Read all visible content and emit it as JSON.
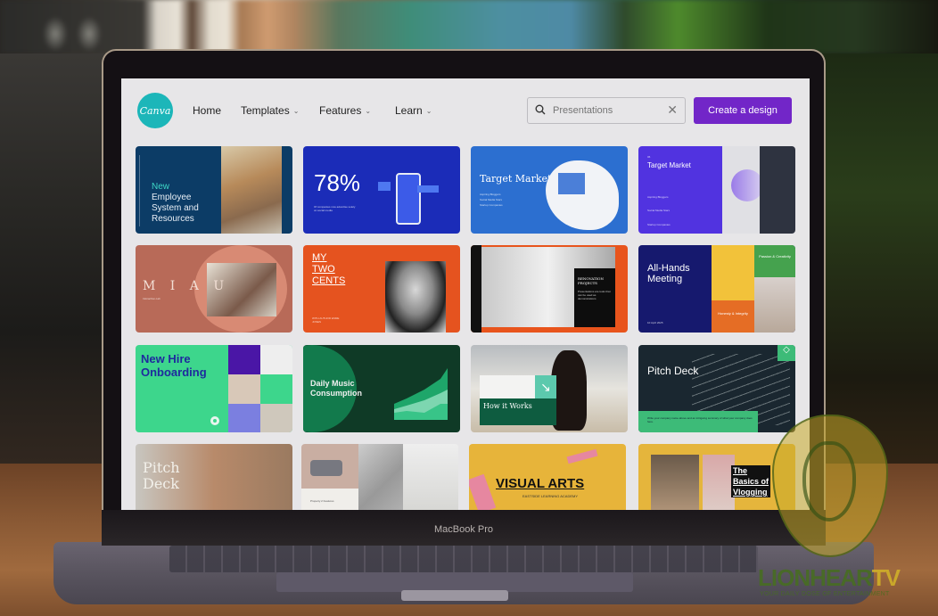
{
  "scene": {
    "device_label": "MacBook Pro",
    "watermark": {
      "brand_main": "LIONHEAR",
      "brand_accent": "TV",
      "tagline": "YOUR DAILY DOSE OF ENTERTAINMENT"
    }
  },
  "header": {
    "logo_text": "Canva",
    "nav": [
      {
        "label": "Home",
        "has_dropdown": false
      },
      {
        "label": "Templates",
        "has_dropdown": true
      },
      {
        "label": "Features",
        "has_dropdown": true
      },
      {
        "label": "Learn",
        "has_dropdown": true
      }
    ],
    "search": {
      "value": "",
      "placeholder": "Presentations"
    },
    "cta_label": "Create a design",
    "cta_color": "#7226c8",
    "brand_color": "#1cb6b9"
  },
  "templates": [
    {
      "title": "New",
      "title2": "Employee System and Resources",
      "bg": "#0c3c66",
      "accent": "#3dd6c6"
    },
    {
      "title": "78%",
      "subtitle": "Of companies now advertise solely on social media",
      "bg": "#1b2cb8"
    },
    {
      "title": "Target Market",
      "items": [
        "Aspiring Bloggers",
        "Social Media Stars",
        "Startup Companies"
      ],
      "bg": "#2c6fd0"
    },
    {
      "eyebrow": "06",
      "title": "Target Market",
      "items": [
        "Aspiring Bloggers",
        "Social Media Stars",
        "Startup Companies"
      ],
      "bg": "#5133e0"
    },
    {
      "title": "M I A U",
      "subtitle": "Interactive Lab",
      "bg": "#b86a58"
    },
    {
      "title_lines": [
        "MY",
        "TWO",
        "CENTS"
      ],
      "subtitle": "WITH AUTHOR ESME JONES",
      "bg": "#e5531f"
    },
    {
      "title": "RENOVATION PROJECTS",
      "subtitle": "Presentations are tools that can be used as demonstrations",
      "bg": "#e8541c"
    },
    {
      "title": "All-Hands Meeting",
      "date": "10 April 2025",
      "tags": [
        "Passion & Creativity",
        "Honesty & Integrity"
      ],
      "bg": "#16196e"
    },
    {
      "title": "New Hire Onboarding",
      "bg": "#3dd68c"
    },
    {
      "title": "Daily Music Consumption",
      "bg": "#0f3a26"
    },
    {
      "title": "How it Works",
      "bg": "#0e5c40"
    },
    {
      "title": "Pitch Deck",
      "subtitle": "Write your company name above and an intriguing summary of what your company does here.",
      "bg": "#1a2730"
    },
    {
      "title": "Pitch Deck",
      "bg": "#b8b2a6"
    },
    {
      "title": "Property 2 Features",
      "bg": "#c9aea2"
    },
    {
      "title": "VISUAL ARTS",
      "subtitle": "EASTSIDE LEARNING ACADEMY",
      "bg": "#e7b43a"
    },
    {
      "title_lines": [
        "The",
        "Basics of",
        "Vlogging"
      ],
      "bg": "#e5b53c"
    }
  ]
}
